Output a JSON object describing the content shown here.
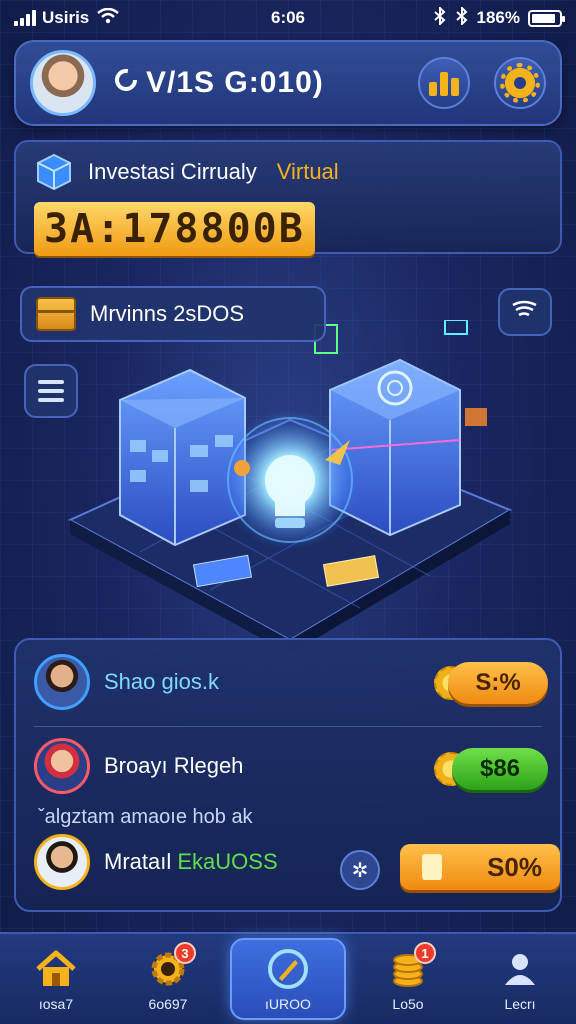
{
  "status_bar": {
    "carrier": "Usiris",
    "time": "6:06",
    "battery": "186%",
    "battery_level": 0.9,
    "icons": [
      "signal-icon",
      "wifi-icon",
      "bluetooth-icon",
      "battery-icon"
    ]
  },
  "header": {
    "title": "V/1S G:010)",
    "icons": [
      "coin-icon",
      "stats-icon",
      "gear-icon"
    ]
  },
  "investment": {
    "title": "Investasi Cirrualy",
    "tag": "Virtual",
    "balance": "3A:178800B"
  },
  "mining": {
    "label": "Mrvinns 2sDOS"
  },
  "players": [
    {
      "name": "Shao gios.k",
      "value": "S:%",
      "pill_color": "#f7a623"
    },
    {
      "name": "Broayı Rlegeh",
      "value": "$86",
      "pill_color": "#44c02a"
    },
    {
      "name": "Mrataıl",
      "name_highlight": "EkaUOSS",
      "value": "S0%",
      "pill_color": "#f7a623"
    }
  ],
  "players_subtext": "ˇalgztam amaoıe hob ak",
  "nav": [
    {
      "label": "ıosa7",
      "icon": "home-icon",
      "badge": ""
    },
    {
      "label": "6o697",
      "icon": "gear-coin-icon",
      "badge": "3"
    },
    {
      "label": "ıUROO",
      "icon": "compass-icon",
      "badge": "",
      "active": true
    },
    {
      "label": "Lo5o",
      "icon": "coins-stack-icon",
      "badge": "1"
    },
    {
      "label": "Lecrı",
      "icon": "user-icon",
      "badge": ""
    }
  ],
  "colors": {
    "accent": "#f6b21a",
    "panel": "#22367a",
    "background": "#1a2660",
    "badge": "#ef3b2c"
  }
}
